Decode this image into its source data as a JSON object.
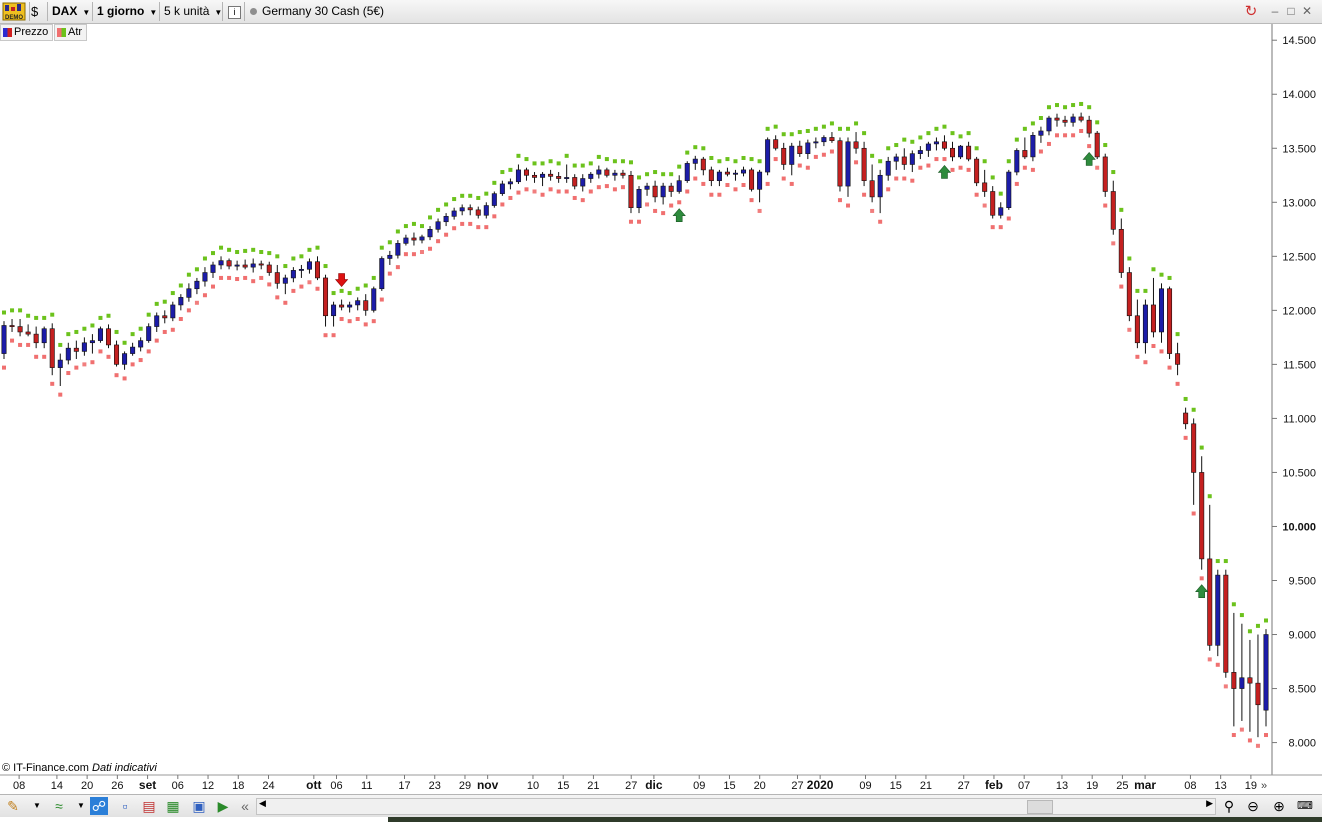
{
  "toolbar": {
    "demo_badge": "DEMO",
    "symbol": "DAX",
    "timeframe": "1 giorno",
    "units": "5 k unità",
    "instrument": "Germany 30 Cash (5€)"
  },
  "legend": [
    {
      "label": "Prezzo",
      "color": "#2b2bd0"
    },
    {
      "label": "Atr",
      "color": "#e05050"
    }
  ],
  "footer": {
    "copyright": "© IT-Finance.com",
    "note": "Dati indicativi"
  },
  "colors": {
    "up_candle": "#1c1ca8",
    "down_candle": "#c42020",
    "atr_above": "#6cc21c",
    "atr_below": "#f07070",
    "buy_arrow": "#2e8b3d",
    "sell_arrow": "#dd1111"
  },
  "chart_data": {
    "type": "candlestick",
    "series": [
      {
        "name": "Prezzo"
      },
      {
        "name": "Atr"
      }
    ],
    "ylim": [
      7700,
      14650
    ],
    "y_ticks": [
      8000,
      8500,
      9000,
      9500,
      10000,
      10500,
      11000,
      11500,
      12000,
      12500,
      13000,
      13500,
      14000,
      14500
    ],
    "y_tick_labels": [
      "8.000",
      "8.500",
      "9.000",
      "9.500",
      "10.000",
      "10.500",
      "11.000",
      "11.500",
      "12.000",
      "12.500",
      "13.000",
      "13.500",
      "14.000",
      "14.500"
    ],
    "y_tick_bold": [
      "10.000"
    ],
    "x_tick_labels": [
      {
        "label": "08",
        "index": 2,
        "bold": false
      },
      {
        "label": "14",
        "index": 7,
        "bold": false
      },
      {
        "label": "20",
        "index": 11,
        "bold": false
      },
      {
        "label": "26",
        "index": 15,
        "bold": false
      },
      {
        "label": "set",
        "index": 19,
        "bold": true
      },
      {
        "label": "06",
        "index": 23,
        "bold": false
      },
      {
        "label": "12",
        "index": 27,
        "bold": false
      },
      {
        "label": "18",
        "index": 31,
        "bold": false
      },
      {
        "label": "24",
        "index": 35,
        "bold": false
      },
      {
        "label": "ott",
        "index": 41,
        "bold": true
      },
      {
        "label": "06",
        "index": 44,
        "bold": false
      },
      {
        "label": "11",
        "index": 48,
        "bold": false
      },
      {
        "label": "17",
        "index": 53,
        "bold": false
      },
      {
        "label": "23",
        "index": 57,
        "bold": false
      },
      {
        "label": "29",
        "index": 61,
        "bold": false
      },
      {
        "label": "nov",
        "index": 64,
        "bold": true
      },
      {
        "label": "10",
        "index": 70,
        "bold": false
      },
      {
        "label": "15",
        "index": 74,
        "bold": false
      },
      {
        "label": "21",
        "index": 78,
        "bold": false
      },
      {
        "label": "27",
        "index": 83,
        "bold": false
      },
      {
        "label": "dic",
        "index": 86,
        "bold": true
      },
      {
        "label": "09",
        "index": 92,
        "bold": false
      },
      {
        "label": "15",
        "index": 96,
        "bold": false
      },
      {
        "label": "20",
        "index": 100,
        "bold": false
      },
      {
        "label": "27",
        "index": 105,
        "bold": false
      },
      {
        "label": "2020",
        "index": 108,
        "bold": true
      },
      {
        "label": "09",
        "index": 114,
        "bold": false
      },
      {
        "label": "15",
        "index": 118,
        "bold": false
      },
      {
        "label": "21",
        "index": 122,
        "bold": false
      },
      {
        "label": "27",
        "index": 127,
        "bold": false
      },
      {
        "label": "feb",
        "index": 131,
        "bold": true
      },
      {
        "label": "07",
        "index": 135,
        "bold": false
      },
      {
        "label": "13",
        "index": 140,
        "bold": false
      },
      {
        "label": "19",
        "index": 144,
        "bold": false
      },
      {
        "label": "25",
        "index": 148,
        "bold": false
      },
      {
        "label": "mar",
        "index": 151,
        "bold": true
      },
      {
        "label": "08",
        "index": 157,
        "bold": false
      },
      {
        "label": "13",
        "index": 161,
        "bold": false
      },
      {
        "label": "19",
        "index": 165,
        "bold": false
      }
    ],
    "candles": [
      [
        11600,
        11900,
        11550,
        11860
      ],
      [
        11860,
        11920,
        11800,
        11850
      ],
      [
        11850,
        11920,
        11760,
        11800
      ],
      [
        11800,
        11870,
        11760,
        11780
      ],
      [
        11780,
        11850,
        11650,
        11700
      ],
      [
        11700,
        11850,
        11650,
        11830
      ],
      [
        11830,
        11880,
        11400,
        11470
      ],
      [
        11470,
        11600,
        11300,
        11540
      ],
      [
        11540,
        11700,
        11500,
        11650
      ],
      [
        11650,
        11720,
        11550,
        11620
      ],
      [
        11620,
        11750,
        11580,
        11700
      ],
      [
        11700,
        11780,
        11600,
        11720
      ],
      [
        11720,
        11850,
        11700,
        11830
      ],
      [
        11830,
        11870,
        11650,
        11680
      ],
      [
        11680,
        11720,
        11480,
        11500
      ],
      [
        11500,
        11620,
        11450,
        11600
      ],
      [
        11600,
        11700,
        11580,
        11660
      ],
      [
        11660,
        11750,
        11620,
        11720
      ],
      [
        11720,
        11880,
        11700,
        11850
      ],
      [
        11850,
        11980,
        11800,
        11950
      ],
      [
        11950,
        12000,
        11880,
        11930
      ],
      [
        11930,
        12080,
        11900,
        12050
      ],
      [
        12050,
        12150,
        12000,
        12120
      ],
      [
        12120,
        12250,
        12080,
        12200
      ],
      [
        12200,
        12300,
        12150,
        12270
      ],
      [
        12270,
        12400,
        12220,
        12350
      ],
      [
        12350,
        12450,
        12300,
        12420
      ],
      [
        12420,
        12500,
        12380,
        12460
      ],
      [
        12460,
        12480,
        12380,
        12410
      ],
      [
        12410,
        12460,
        12370,
        12420
      ],
      [
        12420,
        12470,
        12380,
        12400
      ],
      [
        12400,
        12480,
        12350,
        12430
      ],
      [
        12430,
        12460,
        12380,
        12420
      ],
      [
        12420,
        12450,
        12320,
        12350
      ],
      [
        12350,
        12420,
        12200,
        12250
      ],
      [
        12250,
        12330,
        12150,
        12300
      ],
      [
        12300,
        12400,
        12260,
        12370
      ],
      [
        12370,
        12420,
        12300,
        12380
      ],
      [
        12380,
        12480,
        12340,
        12450
      ],
      [
        12450,
        12500,
        12280,
        12300
      ],
      [
        12300,
        12330,
        11850,
        11950
      ],
      [
        11950,
        12080,
        11850,
        12050
      ],
      [
        12050,
        12100,
        12000,
        12030
      ],
      [
        12030,
        12080,
        11980,
        12050
      ],
      [
        12050,
        12120,
        12000,
        12090
      ],
      [
        12090,
        12150,
        11950,
        12000
      ],
      [
        12000,
        12220,
        11980,
        12200
      ],
      [
        12200,
        12500,
        12180,
        12480
      ],
      [
        12480,
        12550,
        12420,
        12510
      ],
      [
        12510,
        12650,
        12480,
        12620
      ],
      [
        12620,
        12700,
        12600,
        12670
      ],
      [
        12670,
        12720,
        12600,
        12650
      ],
      [
        12650,
        12700,
        12620,
        12680
      ],
      [
        12680,
        12780,
        12650,
        12750
      ],
      [
        12750,
        12850,
        12720,
        12820
      ],
      [
        12820,
        12900,
        12780,
        12870
      ],
      [
        12870,
        12950,
        12840,
        12920
      ],
      [
        12920,
        12980,
        12880,
        12950
      ],
      [
        12950,
        12980,
        12880,
        12930
      ],
      [
        12930,
        12960,
        12850,
        12880
      ],
      [
        12880,
        13000,
        12850,
        12970
      ],
      [
        12970,
        13100,
        12950,
        13080
      ],
      [
        13080,
        13200,
        13060,
        13170
      ],
      [
        13170,
        13220,
        13120,
        13190
      ],
      [
        13190,
        13350,
        13170,
        13300
      ],
      [
        13300,
        13320,
        13200,
        13250
      ],
      [
        13250,
        13280,
        13180,
        13230
      ],
      [
        13230,
        13280,
        13150,
        13260
      ],
      [
        13260,
        13300,
        13200,
        13240
      ],
      [
        13240,
        13280,
        13180,
        13220
      ],
      [
        13220,
        13350,
        13180,
        13230
      ],
      [
        13230,
        13260,
        13120,
        13150
      ],
      [
        13150,
        13260,
        13100,
        13220
      ],
      [
        13220,
        13280,
        13180,
        13260
      ],
      [
        13260,
        13340,
        13220,
        13300
      ],
      [
        13300,
        13320,
        13230,
        13250
      ],
      [
        13250,
        13300,
        13200,
        13270
      ],
      [
        13270,
        13300,
        13220,
        13250
      ],
      [
        13250,
        13290,
        12900,
        12950
      ],
      [
        12950,
        13150,
        12900,
        13120
      ],
      [
        13120,
        13180,
        13060,
        13150
      ],
      [
        13150,
        13200,
        13000,
        13050
      ],
      [
        13050,
        13180,
        12980,
        13150
      ],
      [
        13150,
        13180,
        13050,
        13100
      ],
      [
        13100,
        13250,
        13080,
        13200
      ],
      [
        13200,
        13380,
        13180,
        13360
      ],
      [
        13360,
        13430,
        13300,
        13400
      ],
      [
        13400,
        13420,
        13250,
        13300
      ],
      [
        13300,
        13330,
        13150,
        13200
      ],
      [
        13200,
        13300,
        13150,
        13280
      ],
      [
        13280,
        13320,
        13240,
        13260
      ],
      [
        13260,
        13300,
        13200,
        13270
      ],
      [
        13270,
        13330,
        13240,
        13300
      ],
      [
        13300,
        13320,
        13100,
        13120
      ],
      [
        13120,
        13300,
        13000,
        13280
      ],
      [
        13280,
        13600,
        13250,
        13580
      ],
      [
        13580,
        13620,
        13480,
        13500
      ],
      [
        13500,
        13550,
        13300,
        13350
      ],
      [
        13350,
        13550,
        13250,
        13520
      ],
      [
        13520,
        13570,
        13420,
        13450
      ],
      [
        13450,
        13580,
        13400,
        13550
      ],
      [
        13550,
        13600,
        13500,
        13560
      ],
      [
        13560,
        13620,
        13520,
        13600
      ],
      [
        13600,
        13650,
        13550,
        13570
      ],
      [
        13570,
        13600,
        13100,
        13150
      ],
      [
        13150,
        13600,
        13050,
        13560
      ],
      [
        13560,
        13650,
        13450,
        13500
      ],
      [
        13500,
        13560,
        13150,
        13200
      ]
    ],
    "atr_dots": "alternating stop markers above and below price",
    "signals": [
      {
        "type": "sell",
        "index": 45
      },
      {
        "type": "buy",
        "index": 89
      },
      {
        "type": "buy",
        "index": 124
      },
      {
        "type": "buy",
        "index": 144
      },
      {
        "type": "buy",
        "index": 159
      }
    ]
  }
}
